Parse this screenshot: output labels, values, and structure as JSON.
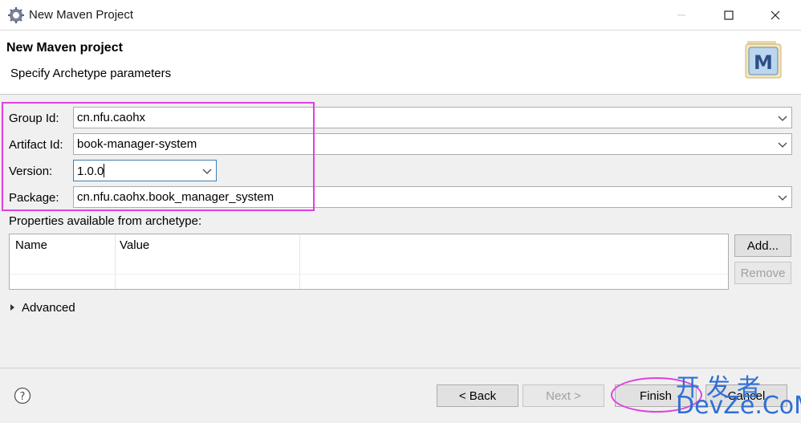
{
  "window": {
    "title": "New Maven Project"
  },
  "banner": {
    "title": "New Maven project",
    "subtitle": "Specify Archetype parameters"
  },
  "form": {
    "group_id_label": "Group Id:",
    "group_id_value": "cn.nfu.caohx",
    "artifact_id_label": "Artifact Id:",
    "artifact_id_value": "book-manager-system",
    "version_label": "Version:",
    "version_value": "1.0.0",
    "package_label": "Package:",
    "package_value": "cn.nfu.caohx.book_manager_system"
  },
  "properties": {
    "label": "Properties available from archetype:",
    "columns": [
      "Name",
      "Value"
    ],
    "add_label": "Add...",
    "remove_label": "Remove"
  },
  "advanced": {
    "label": "Advanced"
  },
  "footer": {
    "back_label": "< Back",
    "next_label": "Next >",
    "finish_label": "Finish",
    "cancel_label": "Cancel"
  },
  "watermark": {
    "line1": "开发者",
    "line2": "DevZe.CoM"
  },
  "colors": {
    "annotation": "#e040e0",
    "watermark": "#2f6fd6",
    "focus": "#3c7fb1"
  }
}
